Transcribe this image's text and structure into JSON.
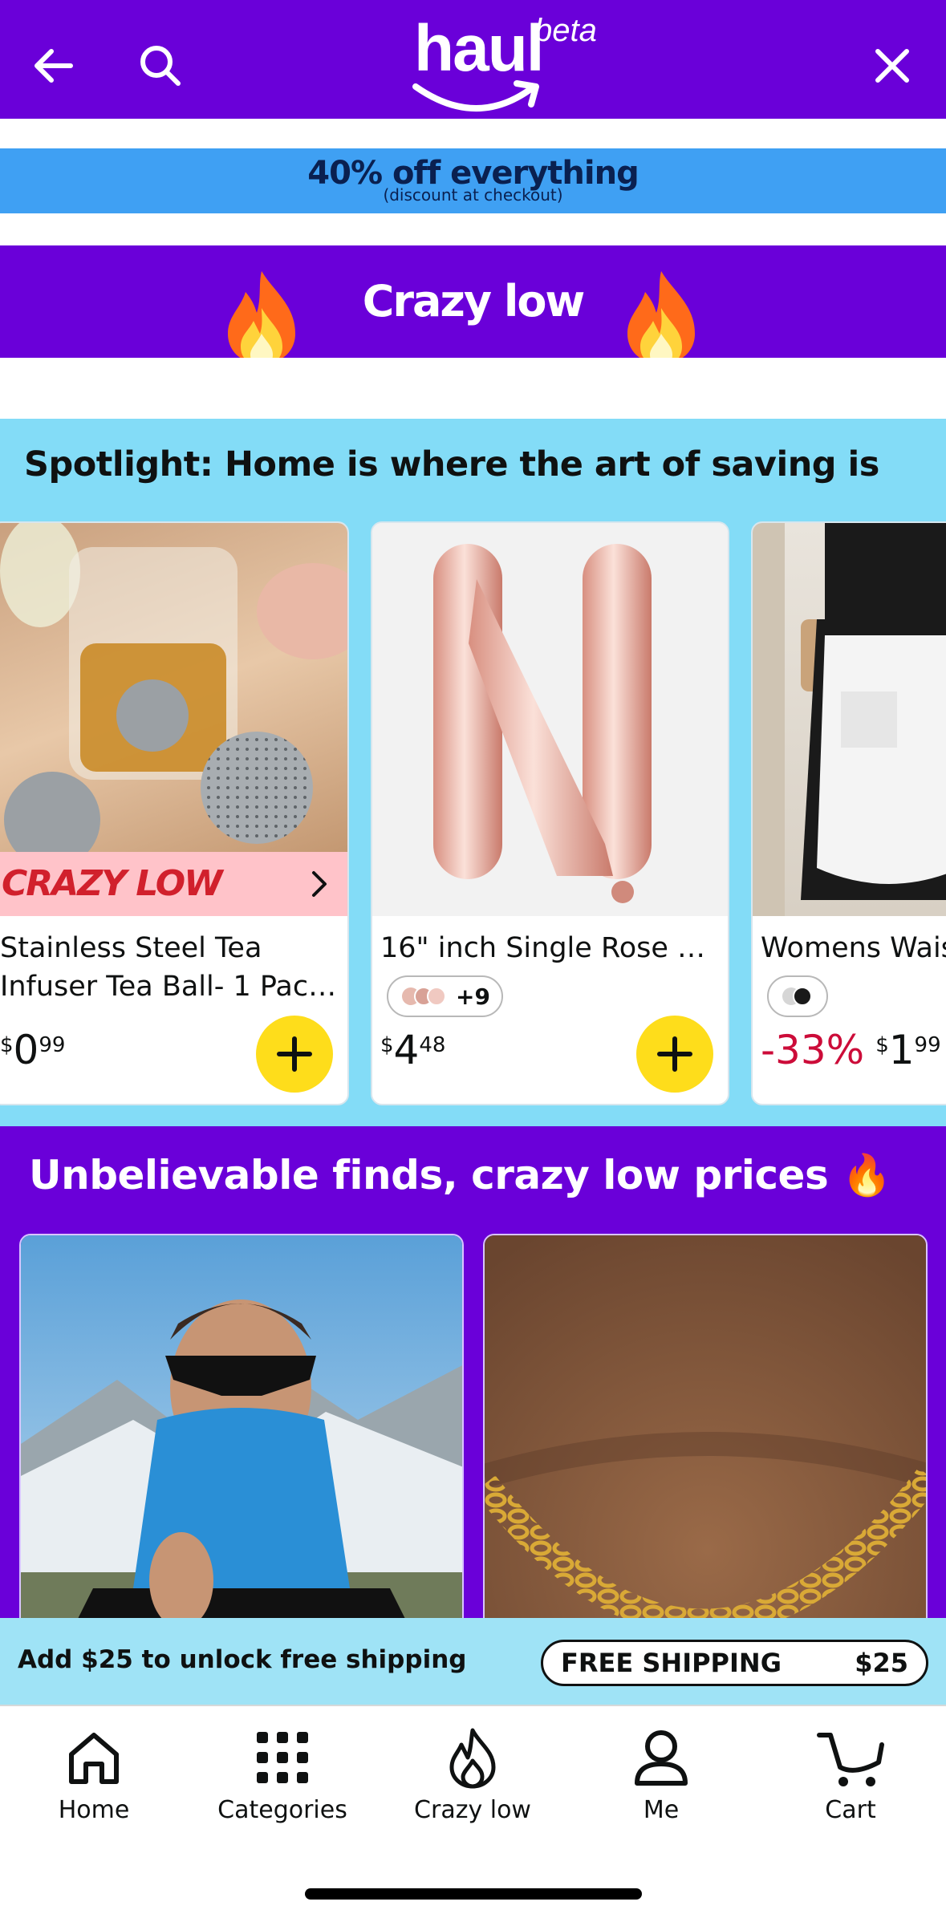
{
  "header": {
    "logo_word": "haul",
    "logo_badge": "beta",
    "back_icon": "arrow-left-icon",
    "search_icon": "search-icon",
    "close_icon": "close-icon",
    "background": "#6a00d9"
  },
  "promo": {
    "main": "40% off everything",
    "sub": "(discount at checkout)",
    "background": "#3fa0f3"
  },
  "crazy_band": {
    "title": "Crazy low"
  },
  "spotlight": {
    "heading": "Spotlight: Home is where the art of saving is",
    "background": "#83dcf7",
    "products": [
      {
        "name": "Stainless Steel Tea Infuser Tea Ball- 1 Pac…",
        "badge": "CRAZY LOW",
        "price_currency": "$",
        "price_whole": "0",
        "price_cents": "99"
      },
      {
        "name": "16\" inch Single Rose G…",
        "swatch_more": "+9",
        "price_currency": "$",
        "price_whole": "4",
        "price_cents": "48"
      },
      {
        "name": "Womens Wais",
        "discount": "-33%",
        "price_currency": "$",
        "price_whole": "1",
        "price_cents": "99"
      }
    ]
  },
  "finds": {
    "heading": "Unbelievable finds, crazy low prices 🔥",
    "background": "#6a00d9"
  },
  "shipping": {
    "message": "Add $25 to unlock free shipping",
    "pill_label": "FREE SHIPPING",
    "pill_amount": "$25"
  },
  "tabs": [
    {
      "label": "Home",
      "icon": "home-icon"
    },
    {
      "label": "Categories",
      "icon": "grid-icon"
    },
    {
      "label": "Crazy low",
      "icon": "flame-icon"
    },
    {
      "label": "Me",
      "icon": "person-icon"
    },
    {
      "label": "Cart",
      "icon": "cart-icon"
    }
  ]
}
